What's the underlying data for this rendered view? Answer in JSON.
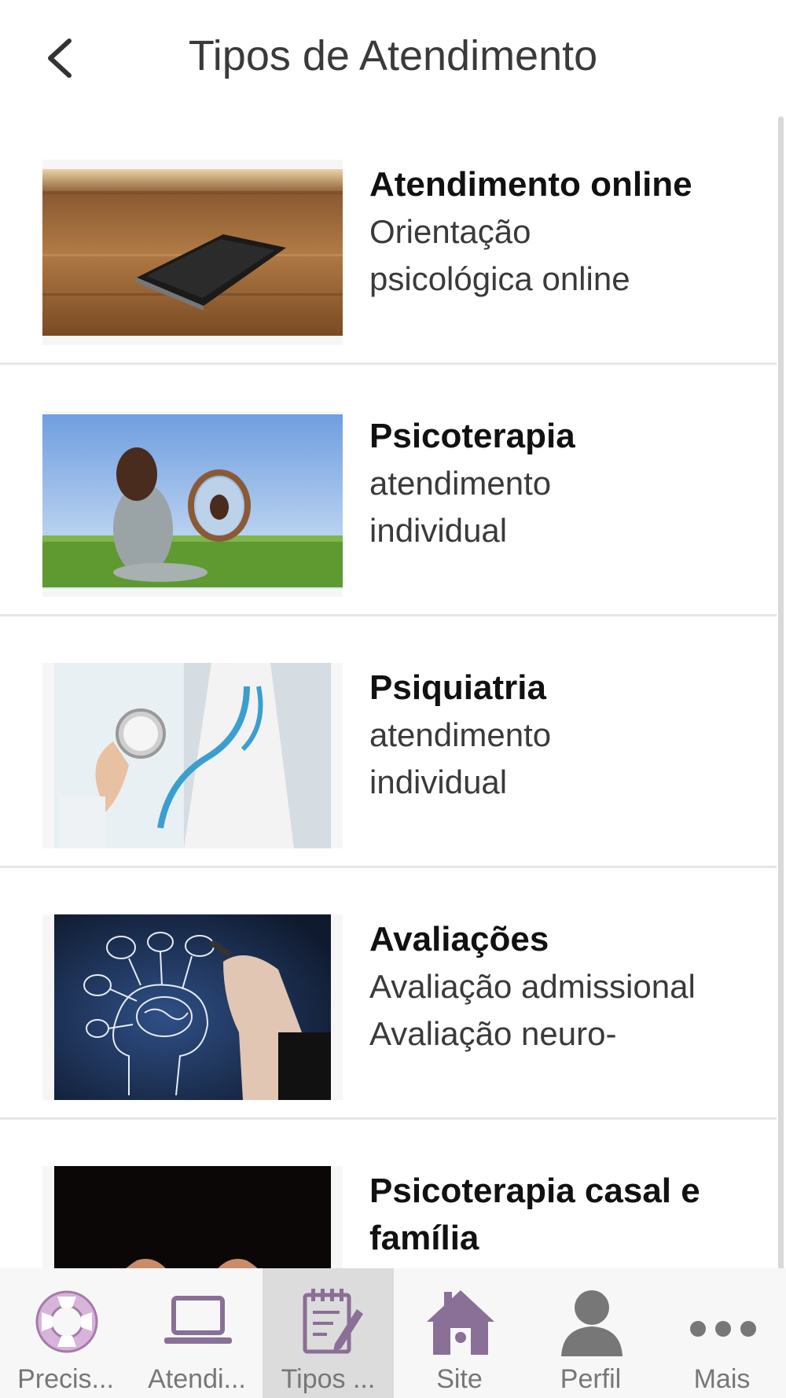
{
  "header": {
    "title": "Tipos de Atendimento",
    "back_icon": "chevron-left-icon"
  },
  "items": [
    {
      "title": "Atendimento online",
      "subtitle": "Orientação\npsicológica online",
      "image": "smartphone-on-table-photo"
    },
    {
      "title": "Psicoterapia",
      "subtitle": "atendimento\nindividual",
      "image": "woman-with-mirror-photo"
    },
    {
      "title": "Psiquiatria",
      "subtitle": "atendimento\nindividual",
      "image": "doctor-stethoscope-photo"
    },
    {
      "title": "Avaliações",
      "subtitle": "Avaliação admissional\nAvaliação neuro-",
      "image": "brain-drawing-photo"
    },
    {
      "title": "Psicoterapia casal e família",
      "subtitle": "",
      "image": "hands-paper-family-photo"
    }
  ],
  "tabbar": {
    "tabs": [
      {
        "label": "Precis...",
        "icon": "lifebuoy-icon",
        "active": false
      },
      {
        "label": "Atendi...",
        "icon": "laptop-icon",
        "active": false
      },
      {
        "label": "Tipos ...",
        "icon": "notepad-icon",
        "active": true
      },
      {
        "label": "Site",
        "icon": "home-icon",
        "active": false
      },
      {
        "label": "Perfil",
        "icon": "user-icon",
        "active": false
      },
      {
        "label": "Mais",
        "icon": "more-dots-icon",
        "active": false
      }
    ]
  },
  "colors": {
    "accent": "#8a6f96",
    "tab_active_bg": "#dcdcdc",
    "divider": "#e6e6e6"
  }
}
